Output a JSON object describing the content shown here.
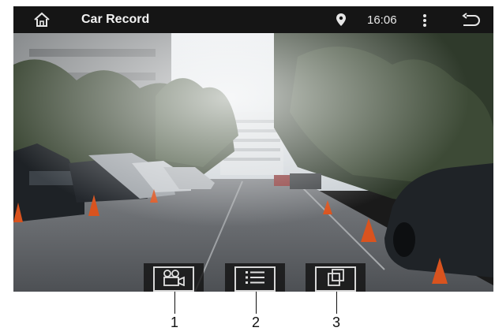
{
  "topbar": {
    "title": "Car Record",
    "time": "16:06",
    "icons": [
      "home-icon",
      "location-pin-icon",
      "more-vert-icon",
      "back-arrow-icon"
    ]
  },
  "toolbar": {
    "buttons": [
      {
        "name": "record-button",
        "icon": "video-camera-icon"
      },
      {
        "name": "list-button",
        "icon": "list-icon"
      },
      {
        "name": "window-button",
        "icon": "overlapping-windows-icon"
      }
    ]
  },
  "callouts": [
    "1",
    "2",
    "3"
  ]
}
